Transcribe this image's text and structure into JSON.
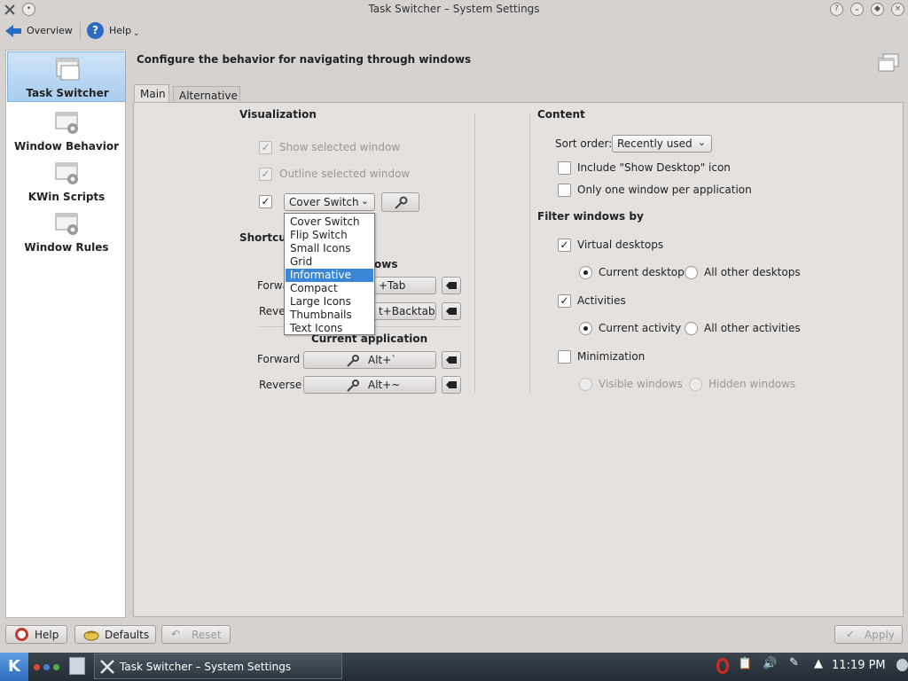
{
  "window": {
    "title": "Task Switcher – System Settings"
  },
  "toolbar": {
    "overview_label": "Overview",
    "help_label": "Help"
  },
  "sidebar": {
    "items": [
      {
        "label": "Task Switcher",
        "active": true
      },
      {
        "label": "Window Behavior",
        "active": false
      },
      {
        "label": "KWin Scripts",
        "active": false
      },
      {
        "label": "Window Rules",
        "active": false
      }
    ]
  },
  "main": {
    "heading": "Configure the behavior for navigating through windows",
    "tabs": [
      {
        "label": "Main",
        "active": true
      },
      {
        "label": "Alternative",
        "active": false
      }
    ]
  },
  "visualization": {
    "title": "Visualization",
    "show_selected_window": {
      "label": "Show selected window",
      "checked": true,
      "enabled": false
    },
    "outline_selected_window": {
      "label": "Outline selected window",
      "checked": true,
      "enabled": false
    },
    "effect_enabled": true,
    "effect_combo_value": "Cover Switch"
  },
  "shortcuts": {
    "title_partial": "Shortcut",
    "all_windows_partial": "ows",
    "forward_label": "Forward",
    "forward_partial": "Forwa",
    "forward_shortcut_partial": "+Tab",
    "reverse_label": "Reverse",
    "reverse_partial": "Rever",
    "reverse_shortcut_partial": "t+Backtab",
    "current_application_label": "Current application",
    "app_forward_shortcut": "Alt+`",
    "app_reverse_shortcut": "Alt+~"
  },
  "dropdown": {
    "options": [
      "Cover Switch",
      "Flip Switch",
      "Small Icons",
      "Grid",
      "Informative",
      "Compact",
      "Large Icons",
      "Thumbnails",
      "Text Icons"
    ],
    "highlighted": "Informative"
  },
  "content": {
    "title": "Content",
    "sort_order_label": "Sort order:",
    "sort_order_value": "Recently used",
    "include_show_desktop": {
      "label": "Include \"Show Desktop\" icon",
      "checked": false
    },
    "one_window_per_app": {
      "label": "Only one window per application",
      "checked": false
    }
  },
  "filter": {
    "title": "Filter windows by",
    "virtual_desktops": {
      "label": "Virtual desktops",
      "checked": true
    },
    "current_desktop": {
      "label": "Current desktop",
      "selected": true
    },
    "all_other_desktops": {
      "label": "All other desktops",
      "selected": false
    },
    "activities": {
      "label": "Activities",
      "checked": true
    },
    "current_activity": {
      "label": "Current activity",
      "selected": true
    },
    "all_other_activities": {
      "label": "All other activities",
      "selected": false
    },
    "minimization": {
      "label": "Minimization",
      "checked": false
    },
    "visible_windows": {
      "label": "Visible windows",
      "selected": false,
      "enabled": false
    },
    "hidden_windows": {
      "label": "Hidden windows",
      "selected": false,
      "enabled": false
    }
  },
  "bottom": {
    "help_label": "Help",
    "defaults_label": "Defaults",
    "reset_label": "Reset",
    "apply_label": "Apply"
  },
  "taskbar": {
    "task_label": "Task Switcher – System Settings",
    "clock": "11:19 PM"
  },
  "colors": {
    "selection": "#3b86d6",
    "sidebar_active": "#a9cdef",
    "taskbar": "#2b333b"
  }
}
